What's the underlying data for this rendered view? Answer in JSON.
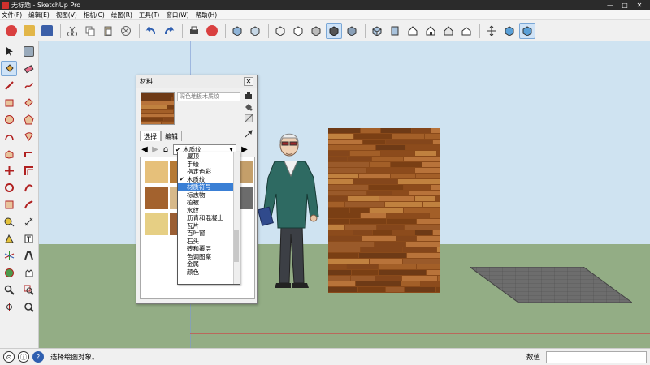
{
  "window": {
    "title": "无标题 - SketchUp Pro",
    "controls": [
      "—",
      "□",
      "✕"
    ]
  },
  "menu": [
    "文件(F)",
    "编辑(E)",
    "视图(V)",
    "相机(C)",
    "绘图(R)",
    "工具(T)",
    "窗口(W)",
    "帮助(H)"
  ],
  "statusbar": {
    "hint": "选择绘图对象。",
    "value_label": "数值",
    "value": ""
  },
  "materials": {
    "title": "材料",
    "close_label": "✕",
    "current_material": "深色地板木质纹",
    "tabs": [
      "选择",
      "编辑"
    ],
    "selected_collection": "木质纹",
    "collections": [
      {
        "label": "屋顶",
        "checked": false,
        "highlighted": false
      },
      {
        "label": "手绘",
        "checked": false,
        "highlighted": false
      },
      {
        "label": "指定色彩",
        "checked": false,
        "highlighted": false
      },
      {
        "label": "木质纹",
        "checked": true,
        "highlighted": false
      },
      {
        "label": "材质符号",
        "checked": false,
        "highlighted": true
      },
      {
        "label": "标志物",
        "checked": false,
        "highlighted": false
      },
      {
        "label": "植被",
        "checked": false,
        "highlighted": false
      },
      {
        "label": "水纹",
        "checked": false,
        "highlighted": false
      },
      {
        "label": "沥青和混凝土",
        "checked": false,
        "highlighted": false
      },
      {
        "label": "瓦片",
        "checked": false,
        "highlighted": false
      },
      {
        "label": "百叶窗",
        "checked": false,
        "highlighted": false
      },
      {
        "label": "石头",
        "checked": false,
        "highlighted": false
      },
      {
        "label": "砖和覆层",
        "checked": false,
        "highlighted": false
      },
      {
        "label": "色调图案",
        "checked": false,
        "highlighted": false
      },
      {
        "label": "金属",
        "checked": false,
        "highlighted": false
      },
      {
        "label": "颜色",
        "checked": false,
        "highlighted": false
      }
    ]
  },
  "colors": {
    "sky": "#cfe3f1",
    "ground": "#93ad85",
    "wood_dark": "#8a4a1a",
    "highlight": "#3a7fd5"
  }
}
